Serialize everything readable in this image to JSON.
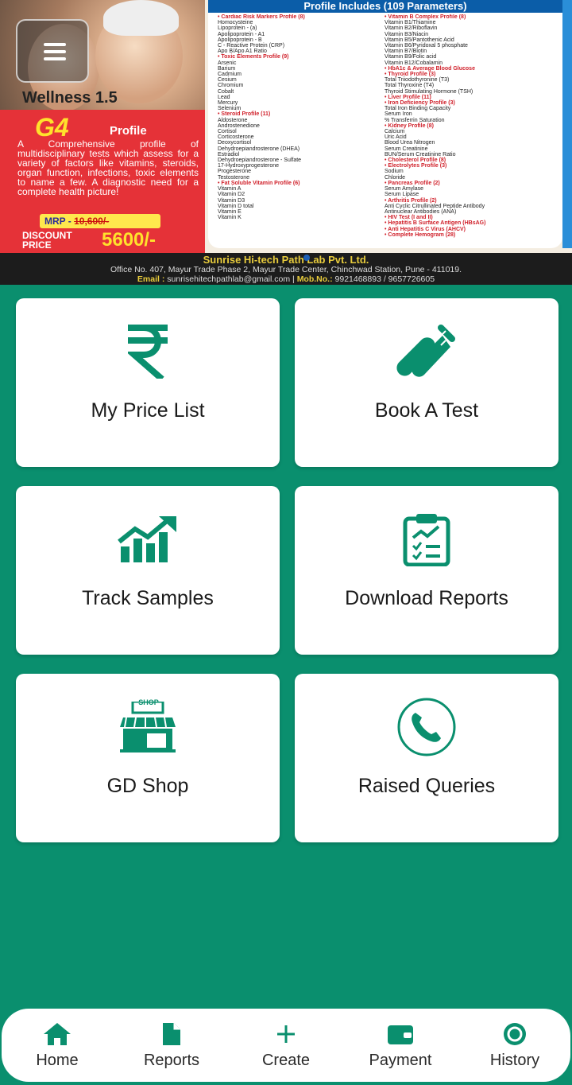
{
  "banner": {
    "product_title": "Wellness 1.5",
    "profile_code": "G4",
    "profile_word": "Profile",
    "description": "A Comprehensive profile of multidisciplinary tests which assess for a variety of factors like vitamins, steroids, organ function, infections, toxic elements to name a few. A diagnostic need for a complete health picture!",
    "mrp_label": "MRP -",
    "mrp_value": "10,600/-",
    "discount_label": "DISCOUNT PRICE",
    "discount_value": "5600/-",
    "params_title": "Profile Includes (109 Parameters)",
    "param_col1": [
      {
        "t": "Cardiac Risk Markers Profile (8)",
        "h": true
      },
      {
        "t": "Homocysteine"
      },
      {
        "t": "Lipoprotein - (a)"
      },
      {
        "t": "Apolipoprotein - A1"
      },
      {
        "t": "Apolipoprotein - B"
      },
      {
        "t": "C - Reactive Protein (CRP)"
      },
      {
        "t": "Apo B/Apo A1 Ratio"
      },
      {
        "t": "Toxic Elements Profile (9)",
        "h": true
      },
      {
        "t": "Arsenic"
      },
      {
        "t": "Barium"
      },
      {
        "t": "Cadmium"
      },
      {
        "t": "Cesium"
      },
      {
        "t": "Chromium"
      },
      {
        "t": "Cobalt"
      },
      {
        "t": "Lead"
      },
      {
        "t": "Mercury"
      },
      {
        "t": "Selenium"
      },
      {
        "t": "Steroid Profile (11)",
        "h": true
      },
      {
        "t": "Aldosterone"
      },
      {
        "t": "Androstenedione"
      },
      {
        "t": "Cortisol"
      },
      {
        "t": "Corticosterone"
      },
      {
        "t": "Deoxycortisol"
      },
      {
        "t": "Dehydroepiandrosterone (DHEA)"
      },
      {
        "t": "Estradiol"
      },
      {
        "t": "Dehydroepiandrosterone - Sulfate"
      },
      {
        "t": "17-Hydroxyprogesterone"
      },
      {
        "t": "Progesterone"
      },
      {
        "t": "Testosterone"
      },
      {
        "t": "Fat Soluble Vitamin Profile (6)",
        "h": true
      },
      {
        "t": "Vitamin A"
      },
      {
        "t": "Vitamin D2"
      },
      {
        "t": "Vitamin D3"
      },
      {
        "t": "Vitamin D total"
      },
      {
        "t": "Vitamin E"
      },
      {
        "t": "Vitamin K"
      }
    ],
    "param_col2": [
      {
        "t": "Vitamin B Complex Profile (8)",
        "h": true
      },
      {
        "t": "Vitamin B1/Thiamine"
      },
      {
        "t": "Vitamin B2/Riboflavin"
      },
      {
        "t": "Vitamin B3/Niacin"
      },
      {
        "t": "Vitamin B5/Pantothenic Acid"
      },
      {
        "t": "Vitamin B6/Pyridoxal 5 phosphate"
      },
      {
        "t": "Vitamin B7/Biotin"
      },
      {
        "t": "Vitamin B9/Folic acid"
      },
      {
        "t": "Vitamin B12/Cobalamin"
      },
      {
        "t": "HbA1c & Average Blood Glucose",
        "h": true
      },
      {
        "t": "Thyroid Profile (3)",
        "h": true
      },
      {
        "t": "Total Triiodothyronine (T3)"
      },
      {
        "t": "Total Thyroxine (T4)"
      },
      {
        "t": "Thyroid Stimulating Hormone (TSH)"
      },
      {
        "t": "Liver Profile (11)",
        "h": true
      },
      {
        "t": "Iron Deficiency Profile (3)",
        "h": true
      },
      {
        "t": "Total Iron Binding Capacity"
      },
      {
        "t": "Serum Iron"
      },
      {
        "t": "% Transferrin Saturation"
      },
      {
        "t": "Kidney Profile (8)",
        "h": true
      },
      {
        "t": "Calcium"
      },
      {
        "t": "Uric Acid"
      },
      {
        "t": "Blood Urea Nitrogen"
      },
      {
        "t": "Serum Creatinine"
      },
      {
        "t": "BUN/Serum Creatinine Ratio"
      },
      {
        "t": "Cholesterol Profile (8)",
        "h": true
      },
      {
        "t": "Electrolytes Profile (3)",
        "h": true
      },
      {
        "t": "Sodium"
      },
      {
        "t": "Chloride"
      },
      {
        "t": "Pancreas Profile (2)",
        "h": true
      },
      {
        "t": "Serum Amylase"
      },
      {
        "t": "Serum Lipase"
      },
      {
        "t": "Arthritis Profile (2)",
        "h": true
      },
      {
        "t": "Anti Cyclic Citrullinated Peptide Antibody"
      },
      {
        "t": "Antinuclear Antibodies (ANA)"
      },
      {
        "t": "HIV Test (I and II)",
        "h": true
      },
      {
        "t": "Hepatitis B Surface Antigen (HBsAG)",
        "h": true
      },
      {
        "t": "Anti Hepatitis C Virus (AHCV)",
        "h": true
      },
      {
        "t": "Complete Hemogram (28)",
        "h": true
      }
    ],
    "lab_name": "Sunrise Hi-tech Path Lab Pvt. Ltd.",
    "lab_address": "Office No. 407, Mayur Trade Phase 2, Mayur Trade Center, Chinchwad Station, Pune - 411019.",
    "email_label": "Email :",
    "email": "sunrisehitechpathlab@gmail.com",
    "mob_label": "Mob.No.:",
    "mobile": "9921468893 / 9657726605"
  },
  "tiles": {
    "price_list": {
      "label": "My Price List",
      "icon": "rupee-icon"
    },
    "book_test": {
      "label": "Book A Test",
      "icon": "test-tube-icon"
    },
    "track_samples": {
      "label": "Track Samples",
      "icon": "growth-chart-icon"
    },
    "download_reports": {
      "label": "Download Reports",
      "icon": "clipboard-report-icon"
    },
    "gd_shop": {
      "label": "GD Shop",
      "icon": "shop-icon"
    },
    "raised_queries": {
      "label": "Raised Queries",
      "icon": "phone-icon"
    }
  },
  "shop_sign": "SHOP",
  "nav": {
    "home": "Home",
    "reports": "Reports",
    "create": "Create",
    "payment": "Payment",
    "history": "History"
  },
  "colors": {
    "background": "#0a8f6e",
    "icon": "#0a8f6e",
    "promo_red": "#e53238",
    "highlight_yellow": "#ffe22c"
  }
}
